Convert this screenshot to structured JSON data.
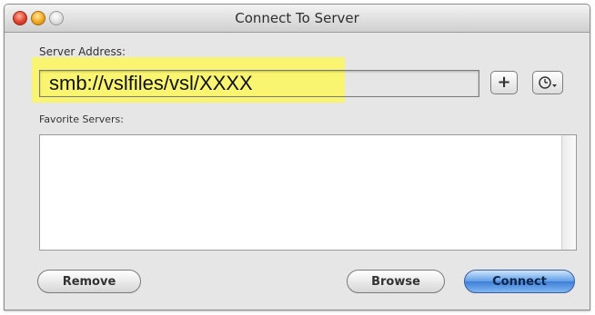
{
  "window": {
    "title": "Connect To Server"
  },
  "server_address": {
    "label": "Server Address:",
    "value": "smb://vslfiles/vsl/XXXX",
    "add_label": "+",
    "recent_icon": "clock-dropdown-icon"
  },
  "favorites": {
    "label": "Favorite Servers:",
    "items": []
  },
  "buttons": {
    "remove": "Remove",
    "browse": "Browse",
    "connect": "Connect"
  },
  "colors": {
    "highlight": "#faf570",
    "primary_button": "#5f9ee8"
  }
}
